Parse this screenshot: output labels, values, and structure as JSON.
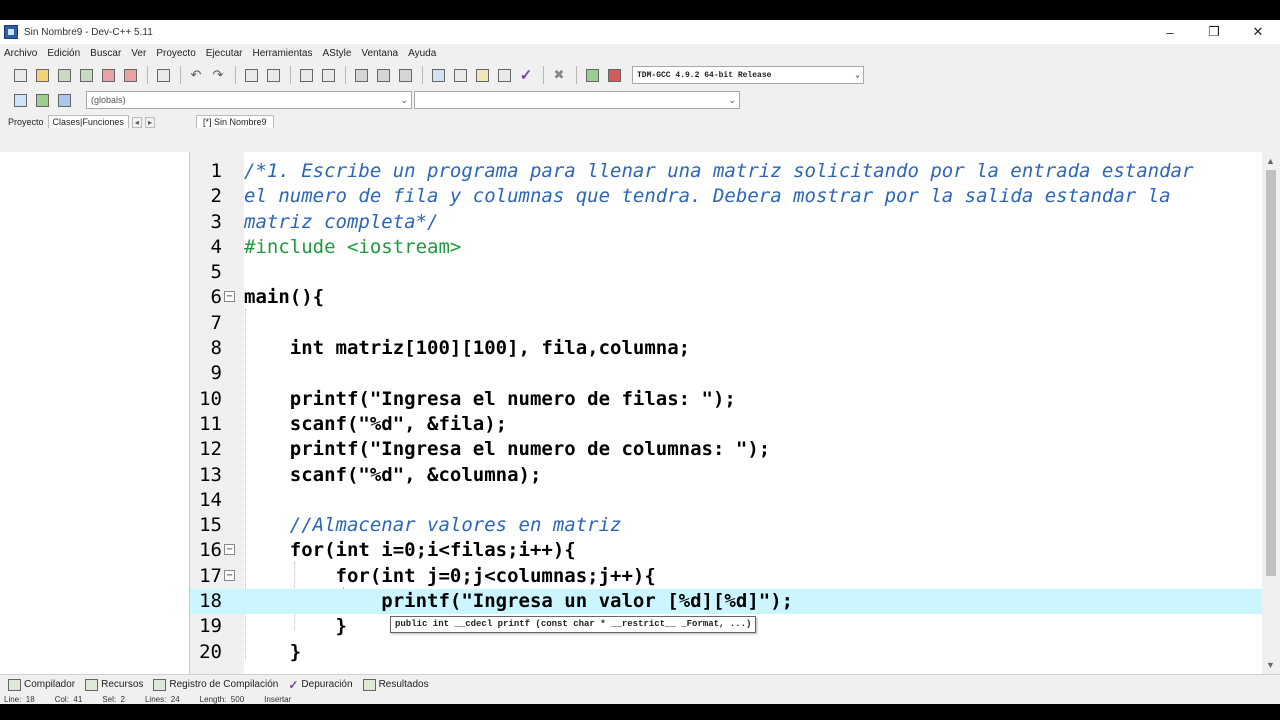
{
  "window": {
    "title": "Sin Nombre9 - Dev-C++ 5.11"
  },
  "menu": [
    "Archivo",
    "Edición",
    "Buscar",
    "Ver",
    "Proyecto",
    "Ejecutar",
    "Herramientas",
    "AStyle",
    "Ventana",
    "Ayuda"
  ],
  "toolbar": {
    "compiler": "TDM-GCC 4.9.2 64-bit Release"
  },
  "toolbar2": {
    "scope": "(globals)",
    "member": ""
  },
  "left_panel": {
    "tabs": [
      "Proyecto",
      "Clases",
      "Funciones"
    ]
  },
  "editor": {
    "tab_label": "[*] Sin Nombre9",
    "lines": [
      {
        "n": "1",
        "text": "/*1. Escribe un programa para llenar una matriz solicitando por la entrada estandar"
      },
      {
        "n": "2",
        "text": "el numero de fila y columnas que tendra. Debera mostrar por la salida estandar la"
      },
      {
        "n": "3",
        "text": "matriz completa*/"
      },
      {
        "n": "4",
        "text": "#include <iostream>"
      },
      {
        "n": "5",
        "text": ""
      },
      {
        "n": "6",
        "text": "main(){"
      },
      {
        "n": "7",
        "text": ""
      },
      {
        "n": "8",
        "text": "    int matriz[100][100], fila,columna;"
      },
      {
        "n": "9",
        "text": ""
      },
      {
        "n": "10",
        "text": "    printf(\"Ingresa el numero de filas: \");"
      },
      {
        "n": "11",
        "text": "    scanf(\"%d\", &fila);"
      },
      {
        "n": "12",
        "text": "    printf(\"Ingresa el numero de columnas: \");"
      },
      {
        "n": "13",
        "text": "    scanf(\"%d\", &columna);"
      },
      {
        "n": "14",
        "text": ""
      },
      {
        "n": "15",
        "text": "    //Almacenar valores en matriz"
      },
      {
        "n": "16",
        "text": "    for(int i=0;i<filas;i++){"
      },
      {
        "n": "17",
        "text": "        for(int j=0;j<columnas;j++){"
      },
      {
        "n": "18",
        "text": "            printf(\"Ingresa un valor [%d][%d]\");"
      },
      {
        "n": "19",
        "text": "        }"
      },
      {
        "n": "20",
        "text": "    }"
      }
    ],
    "tooltip": "public int __cdecl printf (const char * __restrict__ _Format, ...)"
  },
  "bottom_tabs": [
    "Compilador",
    "Recursos",
    "Registro de Compilación",
    "Depuración",
    "Resultados"
  ],
  "status": {
    "line": "Line:  18",
    "col": "Col:  41",
    "sel": "Sel:  2",
    "lines": "Lines:  24",
    "length": "Length:  500",
    "mode": "Insertar"
  }
}
